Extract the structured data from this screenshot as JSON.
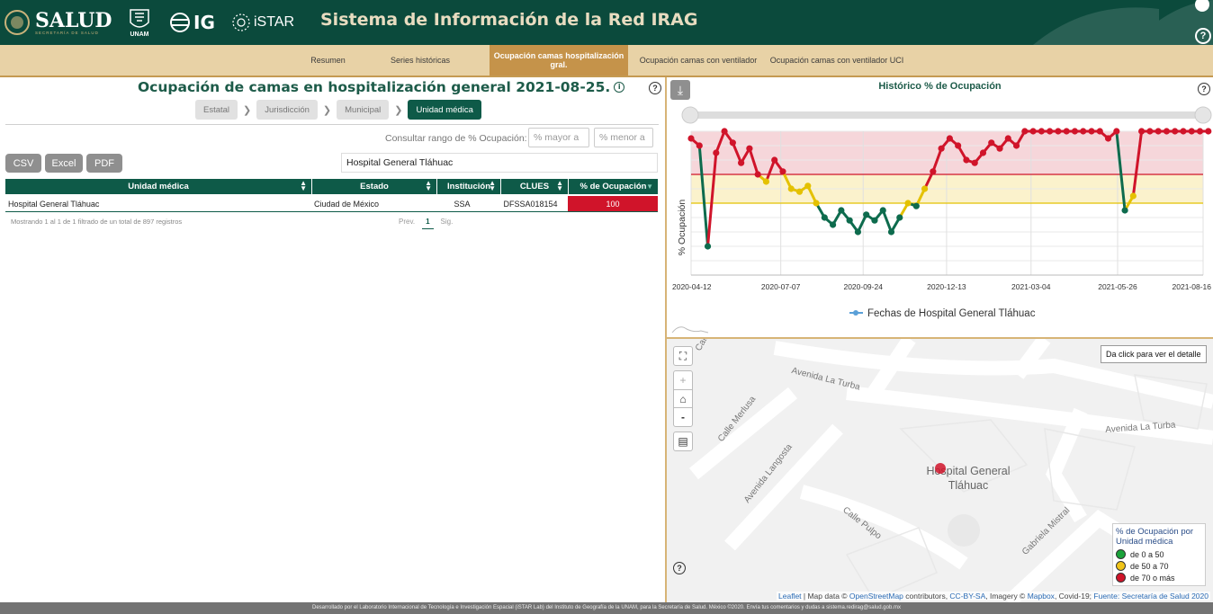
{
  "header": {
    "logo_salud": "SALUD",
    "logo_salud_sub": "SECRETARÍA DE SALUD",
    "logo_unam": "UNAM",
    "logo_ig": "IG",
    "logo_istar": "iSTAR",
    "title": "Sistema de Información de la Red IRAG"
  },
  "nav": {
    "tabs": [
      {
        "label": "Resumen"
      },
      {
        "label": "Series históricas"
      },
      {
        "label": "Ocupación camas hospitalización gral.",
        "active": true
      },
      {
        "label": "Ocupación camas con ventilador"
      },
      {
        "label": "Ocupación camas con ventilador UCI"
      }
    ]
  },
  "panel": {
    "title": "Ocupación de camas en hospitalización general 2021-08-25.",
    "breadcrumbs": [
      "Estatal",
      "Jurisdicción",
      "Municipal",
      "Unidad médica"
    ],
    "range_label": "Consultar rango de % Ocupación:",
    "range_min_placeholder": "% mayor a",
    "range_max_placeholder": "% menor a",
    "export_buttons": [
      "CSV",
      "Excel",
      "PDF"
    ],
    "search_value": "Hospital General Tláhuac"
  },
  "table": {
    "columns": [
      "Unidad médica",
      "Estado",
      "Institución",
      "CLUES",
      "% de Ocupación"
    ],
    "rows": [
      [
        "Hospital General Tláhuac",
        "Ciudad de México",
        "SSA",
        "DFSSA018154",
        "100"
      ]
    ],
    "info": "Mostrando 1 al 1 de 1 filtrado de un total de 897 registros",
    "pager": {
      "prev": "Prev.",
      "current": "1",
      "next": "Sig."
    }
  },
  "chart_title": "Histórico % de Ocupación",
  "chart_data": {
    "type": "line",
    "title": "Histórico % de Ocupación",
    "ylabel": "% Ocupación",
    "xlabel": "",
    "x_tick_labels": [
      "2020-04-12",
      "2020-07-07",
      "2020-09-24",
      "2020-12-13",
      "2021-03-04",
      "2021-05-26",
      "2021-08-16"
    ],
    "ylim": [
      0,
      100
    ],
    "thresholds": [
      50,
      70
    ],
    "series": [
      {
        "name": "Fechas de Hospital General Tláhuac",
        "x": [
          "2020-04-12",
          "2020-04-20",
          "2020-04-28",
          "2020-05-06",
          "2020-05-14",
          "2020-05-22",
          "2020-05-30",
          "2020-06-07",
          "2020-06-15",
          "2020-06-23",
          "2020-07-01",
          "2020-07-09",
          "2020-07-17",
          "2020-07-25",
          "2020-08-02",
          "2020-08-10",
          "2020-08-18",
          "2020-08-26",
          "2020-09-03",
          "2020-09-11",
          "2020-09-19",
          "2020-09-27",
          "2020-10-05",
          "2020-10-13",
          "2020-10-21",
          "2020-10-29",
          "2020-11-06",
          "2020-11-14",
          "2020-11-22",
          "2020-11-30",
          "2020-12-08",
          "2020-12-16",
          "2020-12-24",
          "2021-01-01",
          "2021-01-09",
          "2021-01-17",
          "2021-01-25",
          "2021-02-02",
          "2021-02-10",
          "2021-02-18",
          "2021-02-26",
          "2021-03-06",
          "2021-03-14",
          "2021-03-22",
          "2021-03-30",
          "2021-04-07",
          "2021-04-15",
          "2021-04-23",
          "2021-05-01",
          "2021-05-09",
          "2021-05-17",
          "2021-05-25",
          "2021-06-02",
          "2021-06-10",
          "2021-06-18",
          "2021-06-26",
          "2021-07-04",
          "2021-07-12",
          "2021-07-20",
          "2021-07-28",
          "2021-08-05",
          "2021-08-13",
          "2021-08-21"
        ],
        "values": [
          95,
          90,
          20,
          85,
          100,
          92,
          78,
          88,
          70,
          65,
          80,
          72,
          60,
          58,
          62,
          50,
          40,
          35,
          45,
          38,
          30,
          42,
          38,
          45,
          30,
          40,
          50,
          48,
          60,
          72,
          88,
          95,
          90,
          80,
          78,
          85,
          92,
          88,
          95,
          90,
          100,
          100,
          100,
          100,
          100,
          100,
          100,
          100,
          100,
          100,
          95,
          100,
          45,
          55,
          100,
          100,
          100,
          100,
          100,
          100,
          100,
          100,
          100
        ]
      }
    ]
  },
  "map": {
    "tooltip": "Da click para ver el detalle",
    "streets": [
      "Avenida La Turba",
      "Avenida La Turba",
      "Calle Merlusa",
      "Avenida Langosta",
      "Calle Pulpo",
      "Gabriela Mistral",
      "Calle Perla"
    ],
    "hospital_label": "Hospital General Tláhuac",
    "legend_title": "% de Ocupación por Unidad médica",
    "legend_items": [
      {
        "label": "de 0 a 50",
        "color": "#1aa33a"
      },
      {
        "label": "de 50 a 70",
        "color": "#f0c419"
      },
      {
        "label": "de 70 o más",
        "color": "#d0142a"
      }
    ],
    "attribution_parts": [
      "Leaflet",
      " | Map data © ",
      "OpenStreetMap",
      " contributors, ",
      "CC-BY-SA",
      ", Imagery © ",
      "Mapbox",
      ", Covid-19; ",
      "Fuente: Secretaría de Salud 2020"
    ],
    "controls": {
      "zoom_in": "+",
      "zoom_out": "-"
    }
  },
  "colors": {
    "header_bg": "#0b4a3c",
    "nav_bg": "#e8d2a6",
    "active_tab": "#c5934a",
    "accent_green": "#0e5a48",
    "red": "#d0142a",
    "yellow": "#e4c100",
    "green": "#0d6b4d"
  },
  "footer": "Desarrollado por el Laboratorio Internacional de Tecnología e Investigación Espacial (iSTAR Lab) del Instituto de Geografía de la UNAM, para la Secretaría de Salud. México ©2020. Envía tus comentarios y dudas a sistema.redirag@salud.gob.mx"
}
